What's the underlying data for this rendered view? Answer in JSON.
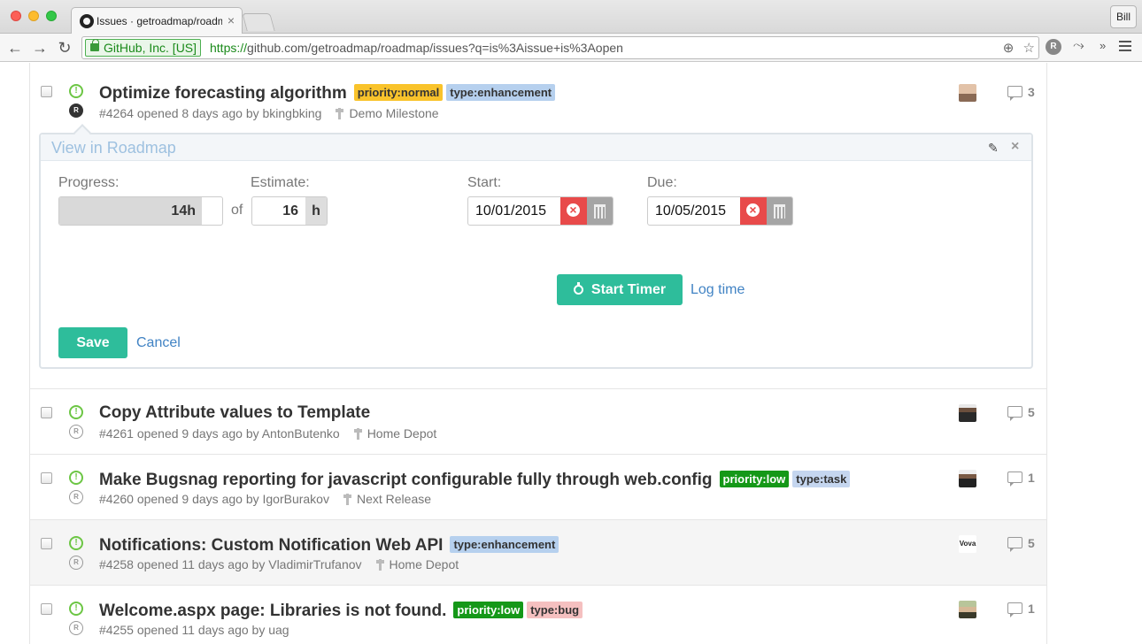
{
  "browser": {
    "tab_title": "Issues · getroadmap/roadmap",
    "tab_close": "×",
    "user_button": "Bill",
    "security_badge": "GitHub, Inc. [US]",
    "url_scheme": "https://",
    "url_rest": "github.com/getroadmap/roadmap/issues?q=is%3Aissue+is%3Aopen",
    "nav": {
      "back": "←",
      "forward": "→",
      "reload": "↻"
    },
    "omnibox_icons": {
      "zoom": "⊕",
      "star": "☆"
    },
    "extension_badge": "R",
    "extension_more": "»"
  },
  "roadmap_panel": {
    "title": "View in Roadmap",
    "progress_label": "Progress:",
    "progress_value": "14h",
    "progress_fraction": 0.875,
    "of_text": "of",
    "estimate_label": "Estimate:",
    "estimate_value": "16",
    "estimate_unit": "h",
    "start_label": "Start:",
    "start_value": "10/01/2015",
    "due_label": "Due:",
    "due_value": "10/05/2015",
    "start_timer": "Start Timer",
    "log_time": "Log time",
    "save": "Save",
    "cancel": "Cancel",
    "edit_icon": "✎",
    "close_icon": "×"
  },
  "issues": [
    {
      "title": "Optimize forecasting algorithm",
      "labels": [
        {
          "text": "priority:normal",
          "color": "#f9c32b"
        },
        {
          "text": "type:enhancement",
          "color": "#b6d0ee"
        }
      ],
      "meta": "#4264 opened 8 days ago by bkingbking",
      "milestone": "Demo Milestone",
      "comments": "3",
      "badge": "R"
    },
    {
      "title": "Copy Attribute values to Template",
      "labels": [],
      "meta": "#4261 opened 9 days ago by AntonButenko",
      "milestone": "Home Depot",
      "comments": "5",
      "badge": "R"
    },
    {
      "title": "Make Bugsnag reporting for javascript configurable fully through web.config",
      "labels": [
        {
          "text": "priority:low",
          "color": "#159818"
        },
        {
          "text": "type:task",
          "color": "#c5d6ef"
        }
      ],
      "meta": "#4260 opened 9 days ago by IgorBurakov",
      "milestone": "Next Release",
      "comments": "1",
      "badge": "R"
    },
    {
      "title": "Notifications: Custom Notification Web API",
      "labels": [
        {
          "text": "type:enhancement",
          "color": "#b6d0ee"
        }
      ],
      "meta": "#4258 opened 11 days ago by VladimirTrufanov",
      "milestone": "Home Depot",
      "comments": "5",
      "badge": "R",
      "avatar_text": "Vova"
    },
    {
      "title": "Welcome.aspx page: Libraries is not found.",
      "labels": [
        {
          "text": "priority:low",
          "color": "#159818"
        },
        {
          "text": "type:bug",
          "color": "#f5c0c0"
        }
      ],
      "meta": "#4255 opened 11 days ago by uag",
      "milestone": "",
      "comments": "1",
      "badge": "R"
    }
  ],
  "open_icon_glyph": "!"
}
